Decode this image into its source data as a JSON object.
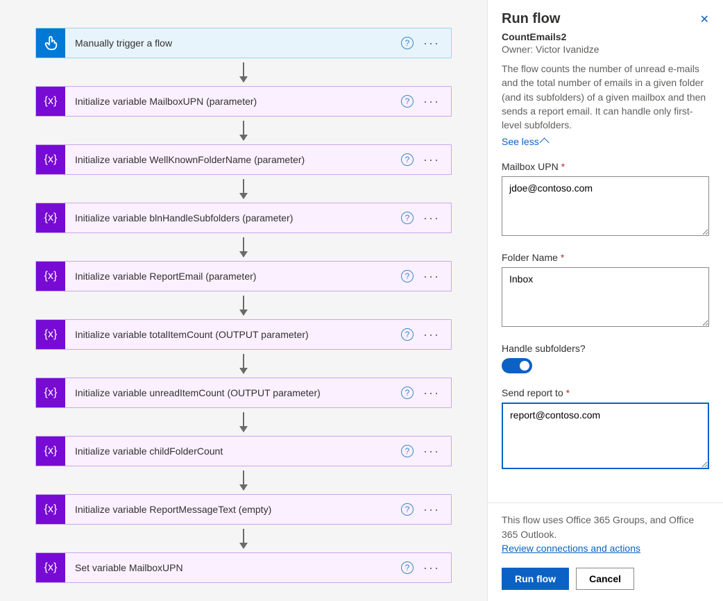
{
  "flow": {
    "trigger": {
      "title": "Manually trigger a flow",
      "iconName": "manual-trigger-icon"
    },
    "steps": [
      {
        "title": "Initialize variable MailboxUPN (parameter)"
      },
      {
        "title": "Initialize variable WellKnownFolderName (parameter)"
      },
      {
        "title": "Initialize variable blnHandleSubfolders (parameter)"
      },
      {
        "title": "Initialize variable ReportEmail (parameter)"
      },
      {
        "title": "Initialize variable totalItemCount (OUTPUT parameter)"
      },
      {
        "title": "Initialize variable unreadItemCount (OUTPUT parameter)"
      },
      {
        "title": "Initialize variable childFolderCount"
      },
      {
        "title": "Initialize variable ReportMessageText (empty)"
      },
      {
        "title": "Set variable MailboxUPN"
      }
    ],
    "varIconText": "{x}"
  },
  "panel": {
    "heading": "Run flow",
    "flowName": "CountEmails2",
    "ownerLabel": "Owner: Victor Ivanidze",
    "description": "The flow counts the number of unread e-mails and the total number of emails in a given folder (and its subfolders) of a given mailbox and then sends a report email. It can handle only first-level subfolders.",
    "seeLess": "See less",
    "fields": {
      "mailbox": {
        "label": "Mailbox UPN",
        "value": "jdoe@contoso.com"
      },
      "folder": {
        "label": "Folder Name",
        "value": "Inbox"
      },
      "handle": {
        "label": "Handle subfolders?"
      },
      "sendto": {
        "label": "Send report to",
        "value": "report@contoso.com"
      }
    },
    "footerUses": "This flow uses Office 365 Groups, and Office 365 Outlook.",
    "reviewLink": "Review connections and actions",
    "runBtn": "Run flow",
    "cancelBtn": "Cancel",
    "closeSymbol": "✕",
    "asterisk": "*"
  }
}
